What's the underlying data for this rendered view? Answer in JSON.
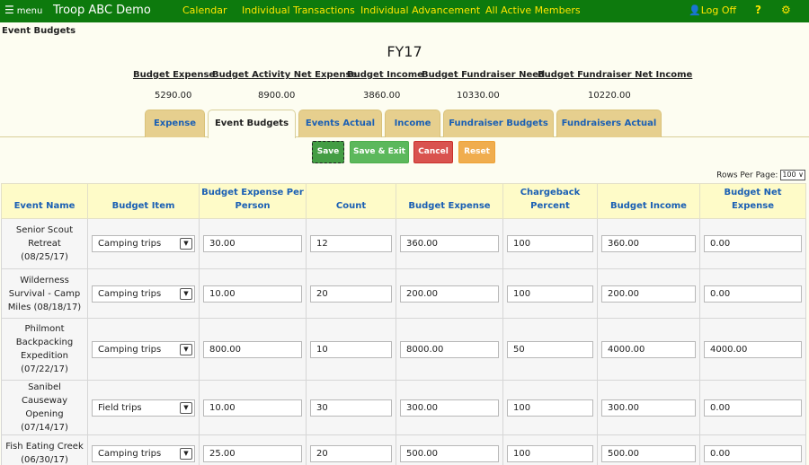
{
  "nav": {
    "menu_label": "menu",
    "brand": "Troop ABC Demo",
    "links": [
      "Calendar",
      "Individual Transactions",
      "Individual Advancement",
      "All Active Members"
    ],
    "logoff": "Log Off",
    "help": "?"
  },
  "page": {
    "heading": "Event Budgets",
    "fiscal_year": "FY17"
  },
  "summary": {
    "labels": [
      "Budget Expense",
      "Budget Activity Net Expense",
      "Budget Income",
      "Budget Fundraiser Need",
      "Budget Fundraiser Net Income"
    ],
    "values": [
      "5290.00",
      "8900.00",
      "3860.00",
      "10330.00",
      "10220.00"
    ]
  },
  "tabs": [
    "Expense",
    "Event Budgets",
    "Events Actual",
    "Income",
    "Fundraiser Budgets",
    "Fundraisers Actual"
  ],
  "active_tab": "Event Budgets",
  "buttons": {
    "save": "Save",
    "save_exit": "Save & Exit",
    "cancel": "Cancel",
    "reset": "Reset"
  },
  "rows_per_page": {
    "label": "Rows Per Page:",
    "value": "100"
  },
  "table": {
    "headers": [
      "Event Name",
      "Budget Item",
      "Budget Expense Per Person",
      "Count",
      "Budget Expense",
      "Chargeback Percent",
      "Budget Income",
      "Budget Net Expense"
    ],
    "rows": [
      {
        "event": [
          "Senior Scout",
          "Retreat",
          "(08/25/17)"
        ],
        "item": "Camping trips",
        "per_person": "30.00",
        "count": "12",
        "expense": "360.00",
        "chargeback": "100",
        "income": "360.00",
        "net": "0.00"
      },
      {
        "event": [
          "Wilderness",
          "Survival - Camp",
          "Miles (08/18/17)"
        ],
        "item": "Camping trips",
        "per_person": "10.00",
        "count": "20",
        "expense": "200.00",
        "chargeback": "100",
        "income": "200.00",
        "net": "0.00"
      },
      {
        "event": [
          "Philmont",
          "Backpacking",
          "Expedition",
          "(07/22/17)"
        ],
        "item": "Camping trips",
        "per_person": "800.00",
        "count": "10",
        "expense": "8000.00",
        "chargeback": "50",
        "income": "4000.00",
        "net": "4000.00"
      },
      {
        "event": [
          "Sanibel Causeway",
          "Opening",
          "(07/14/17)"
        ],
        "item": "Field trips",
        "per_person": "10.00",
        "count": "30",
        "expense": "300.00",
        "chargeback": "100",
        "income": "300.00",
        "net": "0.00"
      },
      {
        "event": [
          "Fish Eating Creek",
          "(06/30/17)"
        ],
        "item": "Camping trips",
        "per_person": "25.00",
        "count": "20",
        "expense": "500.00",
        "chargeback": "100",
        "income": "500.00",
        "net": "0.00"
      }
    ]
  },
  "colors": {
    "nav_bg": "#0d7a0d",
    "nav_link": "#ffe600",
    "tab_bg": "#e6cf8e",
    "header_bg": "#fefbc8",
    "link_blue": "#1a5fb4"
  }
}
